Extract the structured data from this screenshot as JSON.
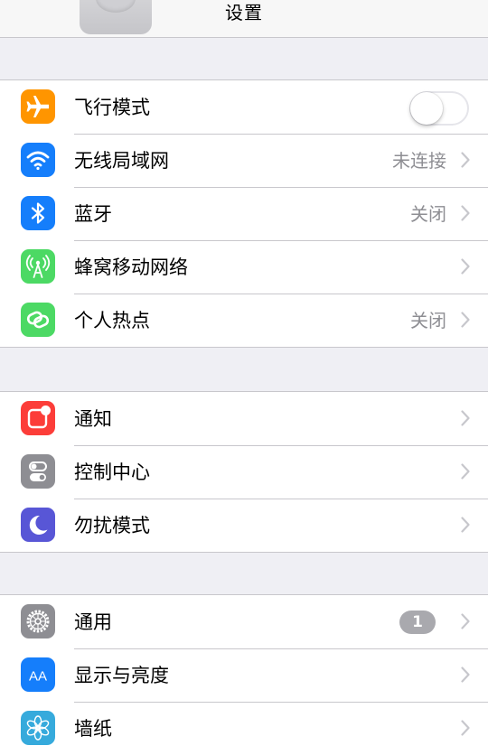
{
  "navbar": {
    "title": "设置"
  },
  "groups": [
    {
      "items": [
        {
          "label": "飞行模式",
          "icon": "airplane-icon",
          "color": "#ff9500",
          "toggle": false
        },
        {
          "label": "无线局域网",
          "icon": "wifi-icon",
          "color": "#157efb",
          "detail": "未连接"
        },
        {
          "label": "蓝牙",
          "icon": "bluetooth-icon",
          "color": "#157efb",
          "detail": "关闭"
        },
        {
          "label": "蜂窝移动网络",
          "icon": "cellular-antenna-icon",
          "color": "#4cd964"
        },
        {
          "label": "个人热点",
          "icon": "hotspot-link-icon",
          "color": "#4cd964",
          "detail": "关闭"
        }
      ]
    },
    {
      "items": [
        {
          "label": "通知",
          "icon": "notifications-icon",
          "color": "#fc3d39"
        },
        {
          "label": "控制中心",
          "icon": "control-center-icon",
          "color": "#8e8e93"
        },
        {
          "label": "勿扰模式",
          "icon": "moon-icon",
          "color": "#5856d6"
        }
      ]
    },
    {
      "items": [
        {
          "label": "通用",
          "icon": "gear-icon",
          "color": "#8e8e93",
          "badge": "1"
        },
        {
          "label": "显示与亮度",
          "icon": "text-size-icon",
          "color": "#157efb",
          "icon_text": "AA"
        },
        {
          "label": "墙纸",
          "icon": "wallpaper-flower-icon",
          "color": "#36aadc"
        }
      ]
    }
  ]
}
